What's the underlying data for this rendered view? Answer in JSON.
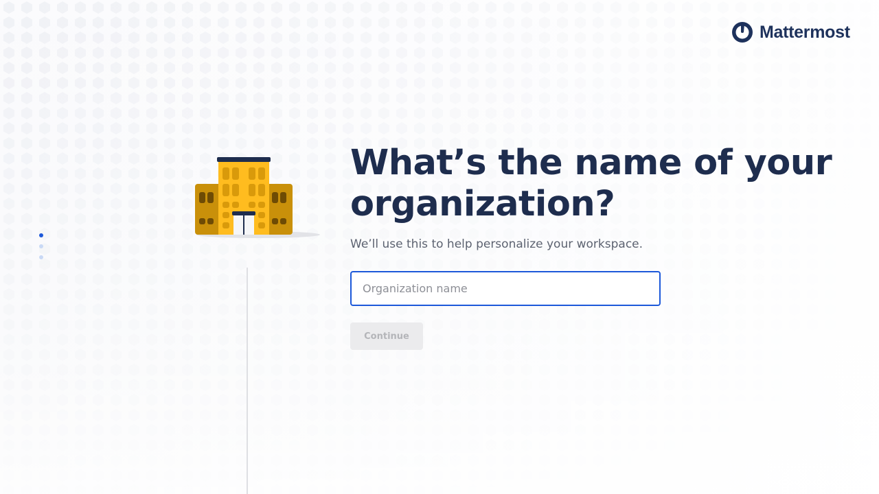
{
  "brand": {
    "name": "Mattermost",
    "icon": "mattermost-logo-icon",
    "color": "#1e325c"
  },
  "onboarding": {
    "title": "What’s the name of your organization?",
    "subtitle": "We’ll use this to help personalize your workspace.",
    "progress": {
      "total_steps": 3,
      "current_step": 1
    }
  },
  "form": {
    "org_name_value": "",
    "org_name_placeholder": "Organization name",
    "continue_label": "Continue",
    "continue_enabled": false
  },
  "illustration": {
    "icon": "building-icon"
  },
  "colors": {
    "accent": "#1c58d9",
    "title": "#1e2d4e",
    "building_main": "#ffbc1f",
    "building_side": "#c9900a"
  }
}
